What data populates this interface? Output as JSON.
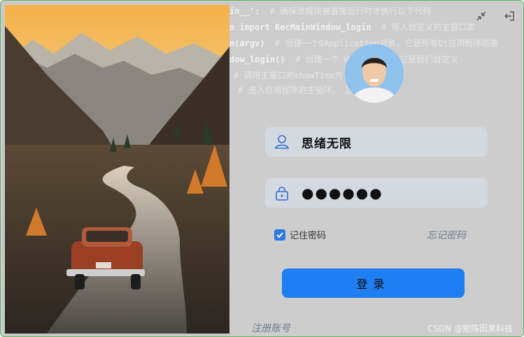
{
  "code_background": {
    "lines": [
      {
        "code": "in__':",
        "comment": "# 确保该模块被直接运行时才执行以下代码"
      },
      {
        "code": "n import RecMainWindow_login",
        "comment": "# 导入自定义的主窗口类"
      },
      {
        "code": "n(argv)",
        "comment": "# 创建一个QApplication对象，它是所有Qt应用程序的基"
      },
      {
        "code": "dow_login()",
        "comment": "# 创建一个  Window对象，它是我们自定义"
      },
      {
        "code": "",
        "comment": "# 调用主窗口的showTime方  时间"
      },
      {
        "code": "",
        "comment": "# 进入应用程序的主循环，  回状态码"
      }
    ]
  },
  "login": {
    "username_value": "思绪无限",
    "password_value": "●●●●●●",
    "remember_label": "记住密码",
    "remember_checked": true,
    "forgot_label": "忘记密码",
    "login_button_label": "登录",
    "register_label": "注册账号"
  },
  "window_controls": {
    "minimize_icon": "collapse-icon",
    "exit_icon": "logout-icon"
  },
  "watermark": "CSDN @矩阵因果科技",
  "colors": {
    "accent": "#1f7ef2",
    "field_bg": "#d4d9e0",
    "panel_bg": "#cdcdcd",
    "window_border": "#5fb55f"
  }
}
